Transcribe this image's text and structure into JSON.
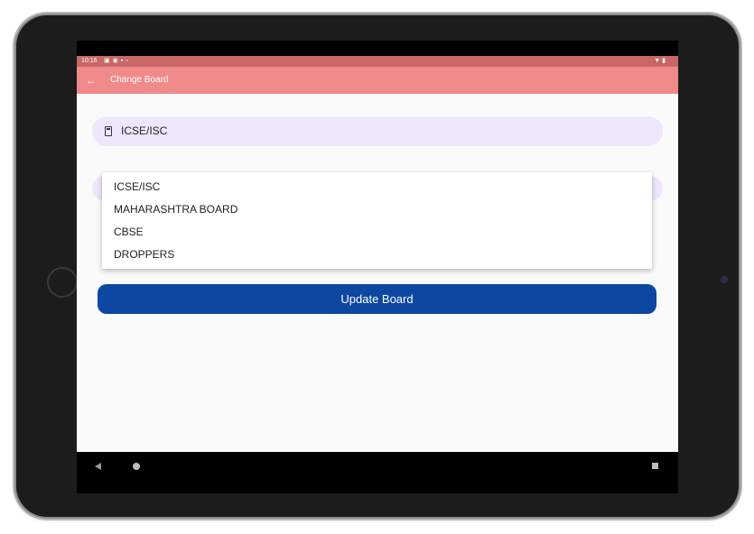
{
  "status_bar": {
    "time": "10:16",
    "left_icons": [
      "notification-icon",
      "message-icon",
      "lock-icon",
      "alert-icon"
    ],
    "right_icons": [
      "wifi-icon",
      "battery-icon"
    ]
  },
  "app_bar": {
    "title": "Change Board",
    "back_icon": "arrow-left-icon"
  },
  "board_field": {
    "icon": "book-icon",
    "value": "ICSE/ISC"
  },
  "dropdown": {
    "options": [
      "ICSE/ISC",
      "MAHARASHTRA BOARD",
      "CBSE",
      "DROPPERS"
    ]
  },
  "update_button": {
    "label": "Update Board"
  },
  "nav_bar": {
    "icons": [
      "back-icon",
      "home-icon",
      "recents-icon"
    ]
  },
  "colors": {
    "app_bar": "#f08a8a",
    "status_bar": "#c96666",
    "field_background": "#efe6fb",
    "button": "#0d47a1"
  }
}
